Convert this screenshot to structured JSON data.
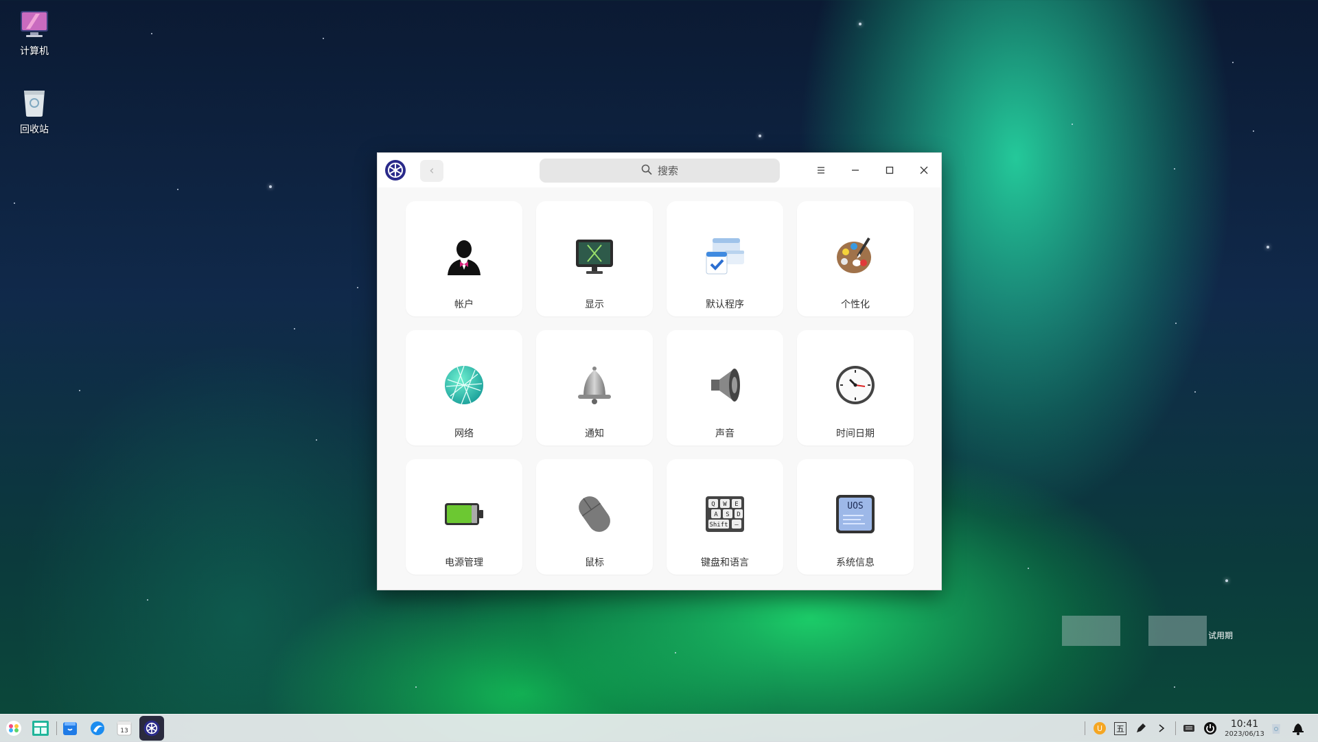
{
  "desktop": {
    "icons": [
      {
        "label": "计算机",
        "icon": "computer-icon"
      },
      {
        "label": "回收站",
        "icon": "trash-icon"
      }
    ],
    "watermark": {
      "text": "试用期"
    }
  },
  "window": {
    "title_logo": "control-center-logo",
    "back_label": "‹",
    "search_placeholder": "搜索",
    "tiles": [
      {
        "label": "帐户",
        "icon": "account-icon"
      },
      {
        "label": "显示",
        "icon": "display-icon"
      },
      {
        "label": "默认程序",
        "icon": "default-apps-icon"
      },
      {
        "label": "个性化",
        "icon": "personalization-icon"
      },
      {
        "label": "网络",
        "icon": "network-icon"
      },
      {
        "label": "通知",
        "icon": "notification-icon"
      },
      {
        "label": "声音",
        "icon": "sound-icon"
      },
      {
        "label": "时间日期",
        "icon": "clock-icon"
      },
      {
        "label": "电源管理",
        "icon": "battery-icon"
      },
      {
        "label": "鼠标",
        "icon": "mouse-icon"
      },
      {
        "label": "键盘和语言",
        "icon": "keyboard-icon"
      },
      {
        "label": "系统信息",
        "icon": "system-info-icon"
      }
    ],
    "keyboard_keys": [
      "Q",
      "W",
      "E",
      "A",
      "S",
      "D",
      "Shift",
      "—"
    ],
    "sysinfo_text": "UOS"
  },
  "taskbar": {
    "calendar_day": "13",
    "ime_label": "五",
    "time": "10:41",
    "date": "2023/06/13"
  },
  "colors": {
    "accent": "#2a2a8a",
    "window_bg": "#f8f8f8",
    "tile_bg": "#ffffff",
    "battery_green": "#6cc832"
  }
}
